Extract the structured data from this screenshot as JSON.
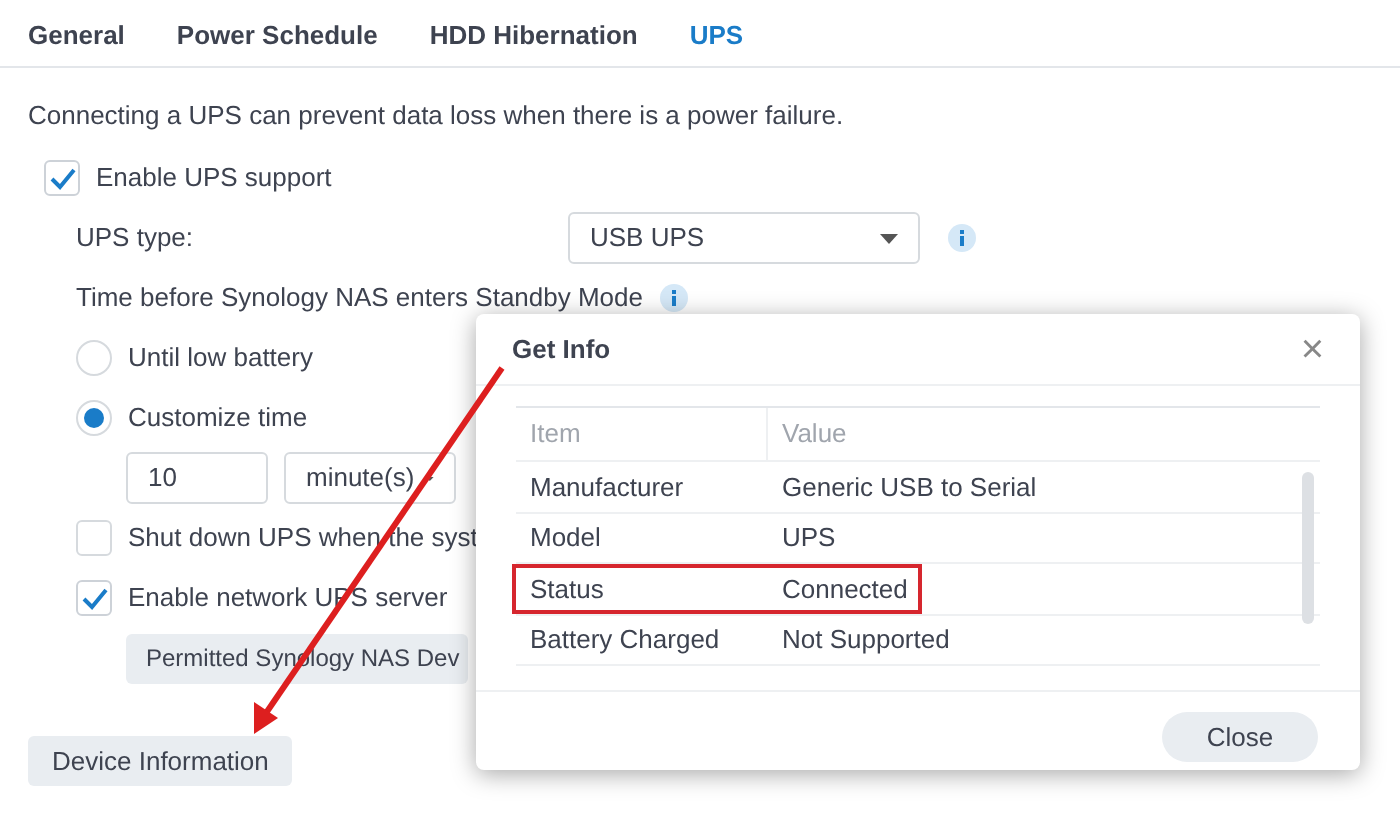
{
  "tabs": [
    {
      "label": "General",
      "selected": false
    },
    {
      "label": "Power Schedule",
      "selected": false
    },
    {
      "label": "HDD Hibernation",
      "selected": false
    },
    {
      "label": "UPS",
      "selected": true
    }
  ],
  "description": "Connecting a UPS can prevent data loss when there is a power failure.",
  "enable_ups": {
    "label": "Enable UPS support",
    "checked": true
  },
  "ups_type": {
    "label": "UPS type:",
    "value": "USB UPS"
  },
  "standby": {
    "label": "Time before Synology NAS enters Standby Mode"
  },
  "standby_options": [
    {
      "label": "Until low battery",
      "selected": false
    },
    {
      "label": "Customize time",
      "selected": true
    }
  ],
  "time": {
    "value": "10",
    "unit": "minute(s)"
  },
  "options": [
    {
      "label": "Shut down UPS when the syst",
      "checked": false
    },
    {
      "label": "Enable network UPS server",
      "checked": true
    }
  ],
  "permitted_button": "Permitted Synology NAS Dev",
  "device_info_button": "Device Information",
  "dialog": {
    "title": "Get Info",
    "close": "×",
    "columns": [
      "Item",
      "Value"
    ],
    "rows": [
      {
        "item": "Manufacturer",
        "value": "Generic USB to Serial",
        "highlighted": false
      },
      {
        "item": "Model",
        "value": "UPS",
        "highlighted": false
      },
      {
        "item": "Status",
        "value": "Connected",
        "highlighted": true
      },
      {
        "item": "Battery Charged",
        "value": "Not Supported",
        "highlighted": false
      }
    ],
    "button": "Close"
  }
}
